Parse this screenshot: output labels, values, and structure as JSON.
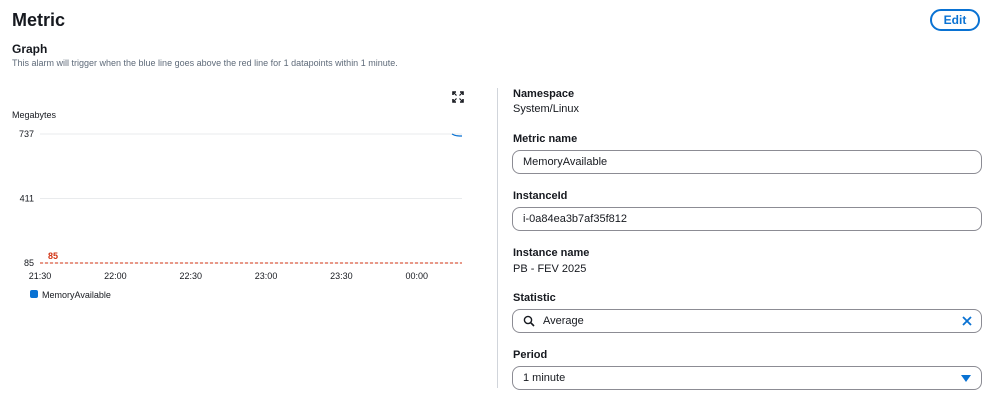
{
  "header": {
    "title": "Metric",
    "edit_label": "Edit"
  },
  "graph": {
    "title": "Graph",
    "description": "This alarm will trigger when the blue line goes above the red line for 1 datapoints within 1 minute."
  },
  "details": {
    "namespace_label": "Namespace",
    "namespace_value": "System/Linux",
    "metric_name_label": "Metric name",
    "metric_name_value": "MemoryAvailable",
    "instance_id_label": "InstanceId",
    "instance_id_value": "i-0a84ea3b7af35f812",
    "instance_name_label": "Instance name",
    "instance_name_value": "PB - FEV 2025",
    "statistic_label": "Statistic",
    "statistic_value": "Average",
    "period_label": "Period",
    "period_value": "1 minute"
  },
  "icons": {
    "expand": "expand-icon",
    "search": "search-icon",
    "clear": "close-icon",
    "dropdown": "caret-down-icon"
  },
  "colors": {
    "accent": "#0972d3",
    "series": "#0972d3",
    "threshold": "#d13212"
  },
  "chart_data": {
    "type": "line",
    "ylabel": "Megabytes",
    "y_ticks": [
      737,
      411,
      85
    ],
    "ylim": [
      85,
      737
    ],
    "x_ticks": [
      "21:30",
      "22:00",
      "22:30",
      "23:00",
      "23:30",
      "00:00"
    ],
    "x": [
      "00:14",
      "00:15",
      "00:16",
      "00:17",
      "00:18"
    ],
    "series": [
      {
        "name": "MemoryAvailable",
        "values": [
          737,
          731,
          728,
          727,
          727
        ]
      }
    ],
    "threshold": {
      "value": 85,
      "label": "85"
    },
    "legend": "bottom-left",
    "grid": true
  }
}
